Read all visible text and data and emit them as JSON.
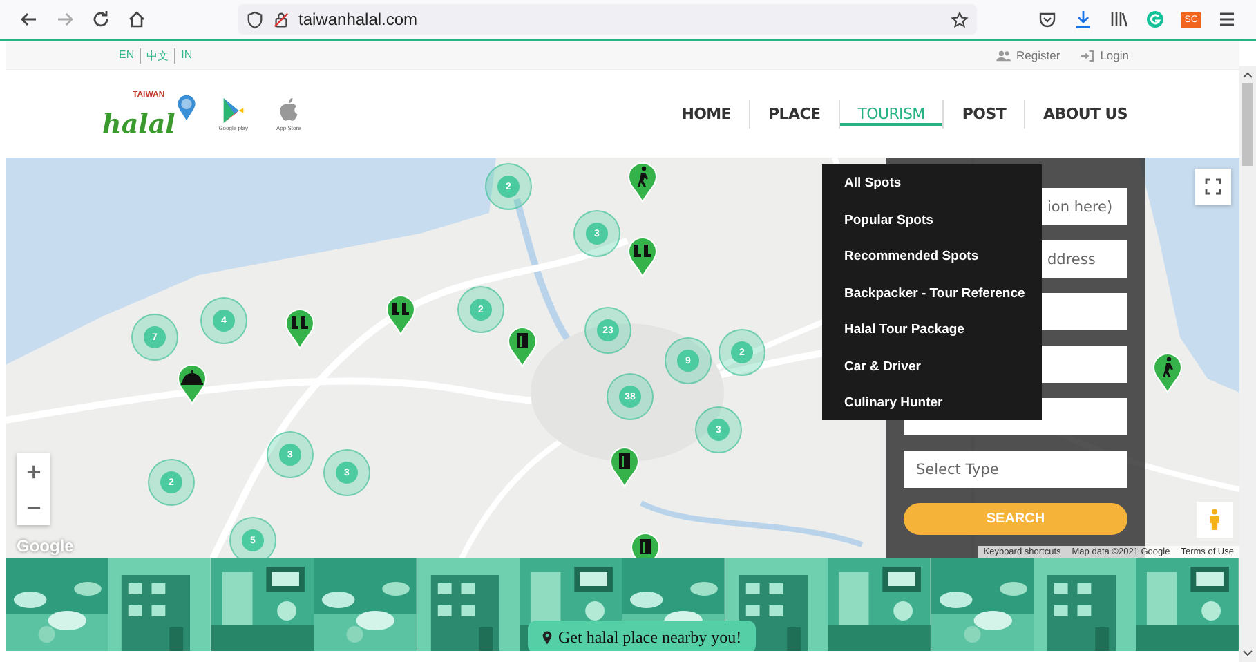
{
  "browser": {
    "url": "taiwanhalal.com",
    "profile_badge": "SC"
  },
  "topbar": {
    "languages": [
      "EN",
      "中文",
      "IN"
    ],
    "register": "Register",
    "login": "Login"
  },
  "logo": {
    "small": "TAIWAN",
    "word": "halal"
  },
  "stores": [
    {
      "kind": "google",
      "caption": "Google play"
    },
    {
      "kind": "apple",
      "caption": "App Store"
    }
  ],
  "nav": [
    {
      "label": "HOME",
      "selected": false
    },
    {
      "label": "PLACE",
      "selected": false
    },
    {
      "label": "TOURISM",
      "selected": true
    },
    {
      "label": "POST",
      "selected": false
    },
    {
      "label": "ABOUT US",
      "selected": false
    }
  ],
  "map": {
    "clusters": [
      {
        "count": "2"
      },
      {
        "count": "3"
      },
      {
        "count": "4"
      },
      {
        "count": "7"
      },
      {
        "count": "2"
      },
      {
        "count": "23"
      },
      {
        "count": "9"
      },
      {
        "count": "2"
      },
      {
        "count": "38"
      },
      {
        "count": "3"
      },
      {
        "count": "3"
      },
      {
        "count": "3"
      },
      {
        "count": "2"
      },
      {
        "count": "5"
      }
    ],
    "attribution": {
      "google": "Google",
      "shortcuts": "Keyboard shortcuts",
      "data": "Map data ©2021 Google",
      "terms": "Terms of Use"
    }
  },
  "search": {
    "fields": [
      {
        "kind": "text",
        "placeholder": "ion here)"
      },
      {
        "kind": "text",
        "placeholder": "ddress"
      },
      {
        "kind": "text"
      },
      {
        "kind": "text"
      },
      {
        "kind": "text"
      },
      {
        "kind": "text",
        "placeholder": "Select Type"
      }
    ],
    "button": "SEARCH"
  },
  "menu": [
    "All Spots",
    "Popular Spots",
    "Recommended Spots",
    "Backpacker - Tour Reference",
    "Halal Tour Package",
    "Car & Driver",
    "Culinary Hunter"
  ],
  "strip": {
    "button": "Get halal place nearby you!"
  }
}
